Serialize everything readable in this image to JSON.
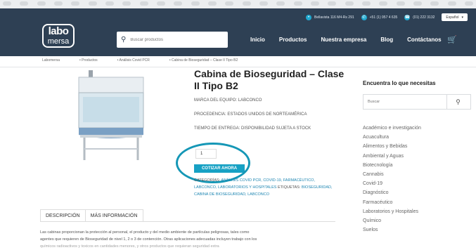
{
  "header": {
    "contacts": [
      {
        "icon": "location-pin-icon",
        "text": "Bellavista 116 M4-Rs 291"
      },
      {
        "icon": "whatsapp-icon",
        "text": "+51 (1) 957 4 635"
      },
      {
        "icon": "phone-icon",
        "text": "(01) 222 3132"
      }
    ],
    "language": "Español",
    "logo_line1": "labo",
    "logo_line2": "mersa",
    "search_placeholder": "Buscar productos",
    "nav": [
      "Inicio",
      "Productos",
      "Nuestra empresa",
      "Blog",
      "Contáctanos"
    ]
  },
  "breadcrumb": [
    "Labomersa",
    "• Productos",
    "• Análisis Covid PCR",
    "• Cabina de Bioseguridad – Clase II Tipo B2"
  ],
  "product": {
    "title": "Cabina de Bioseguridad – Clase II Tipo B2",
    "brand": "MARCA DEL EQUIPO: LABCONCO",
    "origin": "PROCEDENCIA: ESTADOS UNIDOS DE NORTEAMÉRICA",
    "delivery": "TIEMPO DE ENTREGA: DISPONIBILIDAD SUJETA A STOCK",
    "quantity": "1",
    "quote_button": "COTIZAR AHORA",
    "categories_label": "CATEGORÍAS:",
    "categories_links": "ANÁLISIS COVID PCR, COVID-19, FARMACÉUTICO, LABCONCO, LABORATORIOS Y HOSPITALES",
    "tags_label": "ETIQUETAS:",
    "tags_links": "BIOSEGURIDAD, CABINA DE BIOSEGURIDAD, LABCONCO"
  },
  "tabs": [
    "DESCRIPCIÓN",
    "MÁS INFORMACIÓN"
  ],
  "description": {
    "line1": "Las cabinas proporcionan la protección al personal, el producto y del medio ambiente de partículas peligrosas, tales como",
    "line2": "agentes que requieren de Bioseguridad de nivel 1, 2 o 3 de contención. Otras aplicaciones adecuadas incluyen trabajo con los",
    "line3": "químicos radioactivos y toxicos en cantidades menores, y otros productos que requieran seguridad extra"
  },
  "sidebar": {
    "title": "Encuentra lo que necesitas",
    "search_placeholder": "Buscar",
    "categories": [
      "Académico e investigación",
      "Acuacultura",
      "Alimentos y Bebidas",
      "Ambiental y Aguas",
      "Biotecnología",
      "Cannabis",
      "Covid-19",
      "Diagnóstico",
      "Farmacéutico",
      "Laboratorios y Hospitales",
      "Químico",
      "Suelos"
    ]
  },
  "colors": {
    "header_bg": "#2e4054",
    "accent": "#17a1c4"
  }
}
